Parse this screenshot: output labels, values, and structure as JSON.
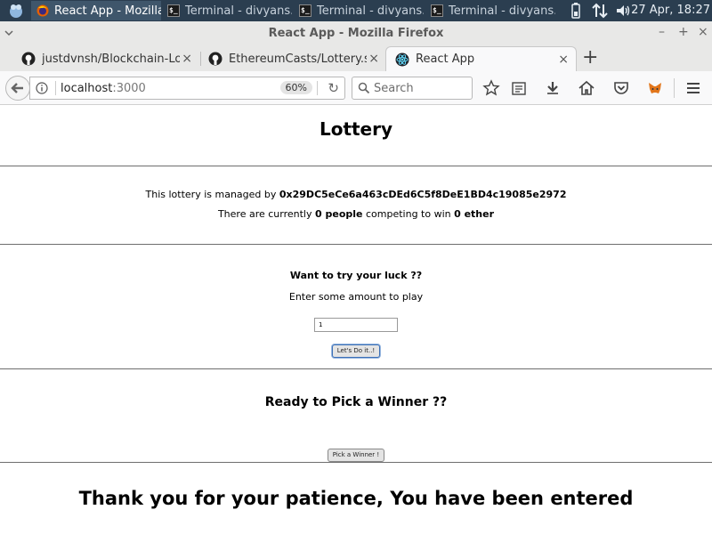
{
  "panel": {
    "tasks": [
      {
        "label": "React App - Mozilla...",
        "icon": "firefox-icon"
      },
      {
        "label": "Terminal - divyans...",
        "icon": "terminal-icon"
      },
      {
        "label": "Terminal - divyans...",
        "icon": "terminal-icon"
      },
      {
        "label": "Terminal - divyans...",
        "icon": "terminal-icon"
      }
    ],
    "clock": "27 Apr, 18:27"
  },
  "window": {
    "title": "React App - Mozilla Firefox"
  },
  "tabs": [
    {
      "label": "justdvnsh/Blockchain-Lottery",
      "icon": "github-icon"
    },
    {
      "label": "EthereumCasts/Lottery.sol",
      "icon": "github-icon"
    },
    {
      "label": "React App",
      "icon": "react-icon"
    }
  ],
  "navbar": {
    "url_host": "localhost",
    "url_port": ":3000",
    "zoom": "60%",
    "search_placeholder": "Search"
  },
  "page": {
    "title": "Lottery",
    "manager_prefix": "This lottery is managed by ",
    "manager_address": "0x29DC5eCe6a463cDEd6C5f8DeE1BD4c19085e2972",
    "players_prefix": "There are currently ",
    "players_count": "0 people",
    "players_middle": " competing to win ",
    "balance": "0 ether",
    "try_heading": "Want to try your luck ??",
    "amount_label": "Enter some amount to play",
    "amount_value": "1",
    "enter_button": "Let's Do it..!",
    "pick_heading": "Ready to Pick a Winner ??",
    "pick_button": "Pick a Winner !",
    "message": "Thank you for your patience, You have been entered"
  }
}
